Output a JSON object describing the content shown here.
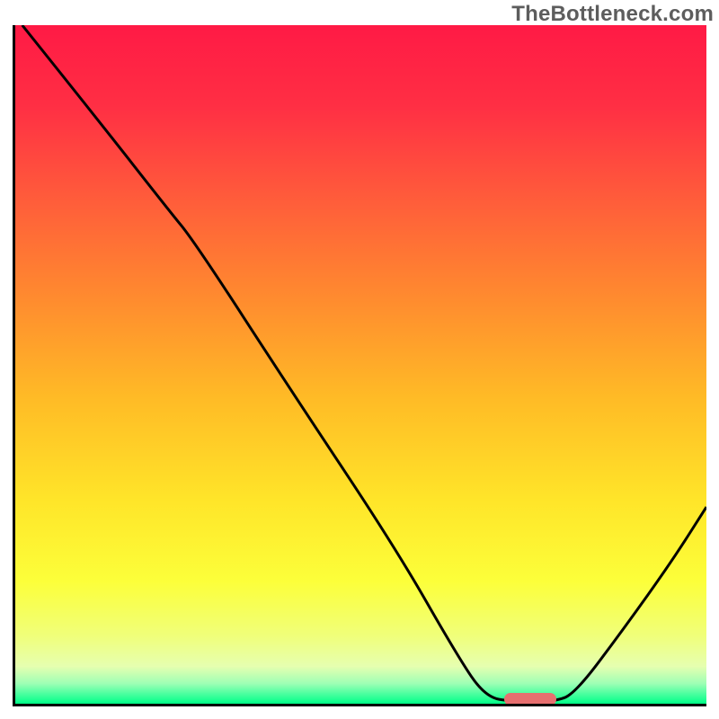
{
  "watermark": "TheBottleneck.com",
  "colors": {
    "axis": "#000000",
    "curve": "#000000",
    "marker": "#e76f6f",
    "gradient_stops": [
      {
        "offset": 0.0,
        "color": "#ff1a45"
      },
      {
        "offset": 0.12,
        "color": "#ff2f44"
      },
      {
        "offset": 0.25,
        "color": "#ff5a3b"
      },
      {
        "offset": 0.4,
        "color": "#ff8a2f"
      },
      {
        "offset": 0.55,
        "color": "#ffbb26"
      },
      {
        "offset": 0.7,
        "color": "#ffe529"
      },
      {
        "offset": 0.82,
        "color": "#fcff3a"
      },
      {
        "offset": 0.9,
        "color": "#f0ff7a"
      },
      {
        "offset": 0.945,
        "color": "#e6ffb0"
      },
      {
        "offset": 0.97,
        "color": "#9fffb5"
      },
      {
        "offset": 0.985,
        "color": "#4dffa0"
      },
      {
        "offset": 1.0,
        "color": "#00ff88"
      }
    ]
  },
  "chart_data": {
    "type": "line",
    "xlabel": "",
    "ylabel": "",
    "xlim": [
      0,
      100
    ],
    "ylim": [
      0,
      100
    ],
    "grid": false,
    "legend": false,
    "series": [
      {
        "name": "bottleneck-curve",
        "points": [
          {
            "x": 1,
            "y": 100
          },
          {
            "x": 12,
            "y": 86
          },
          {
            "x": 22,
            "y": 73
          },
          {
            "x": 26,
            "y": 68
          },
          {
            "x": 40,
            "y": 46
          },
          {
            "x": 55,
            "y": 23
          },
          {
            "x": 64,
            "y": 7
          },
          {
            "x": 68,
            "y": 1
          },
          {
            "x": 72,
            "y": 0.3
          },
          {
            "x": 78,
            "y": 0.3
          },
          {
            "x": 81,
            "y": 1.5
          },
          {
            "x": 88,
            "y": 11
          },
          {
            "x": 95,
            "y": 21
          },
          {
            "x": 100,
            "y": 29
          }
        ]
      }
    ],
    "marker": {
      "x": 74.5,
      "y": 0.6,
      "label": "optimal-range"
    }
  }
}
